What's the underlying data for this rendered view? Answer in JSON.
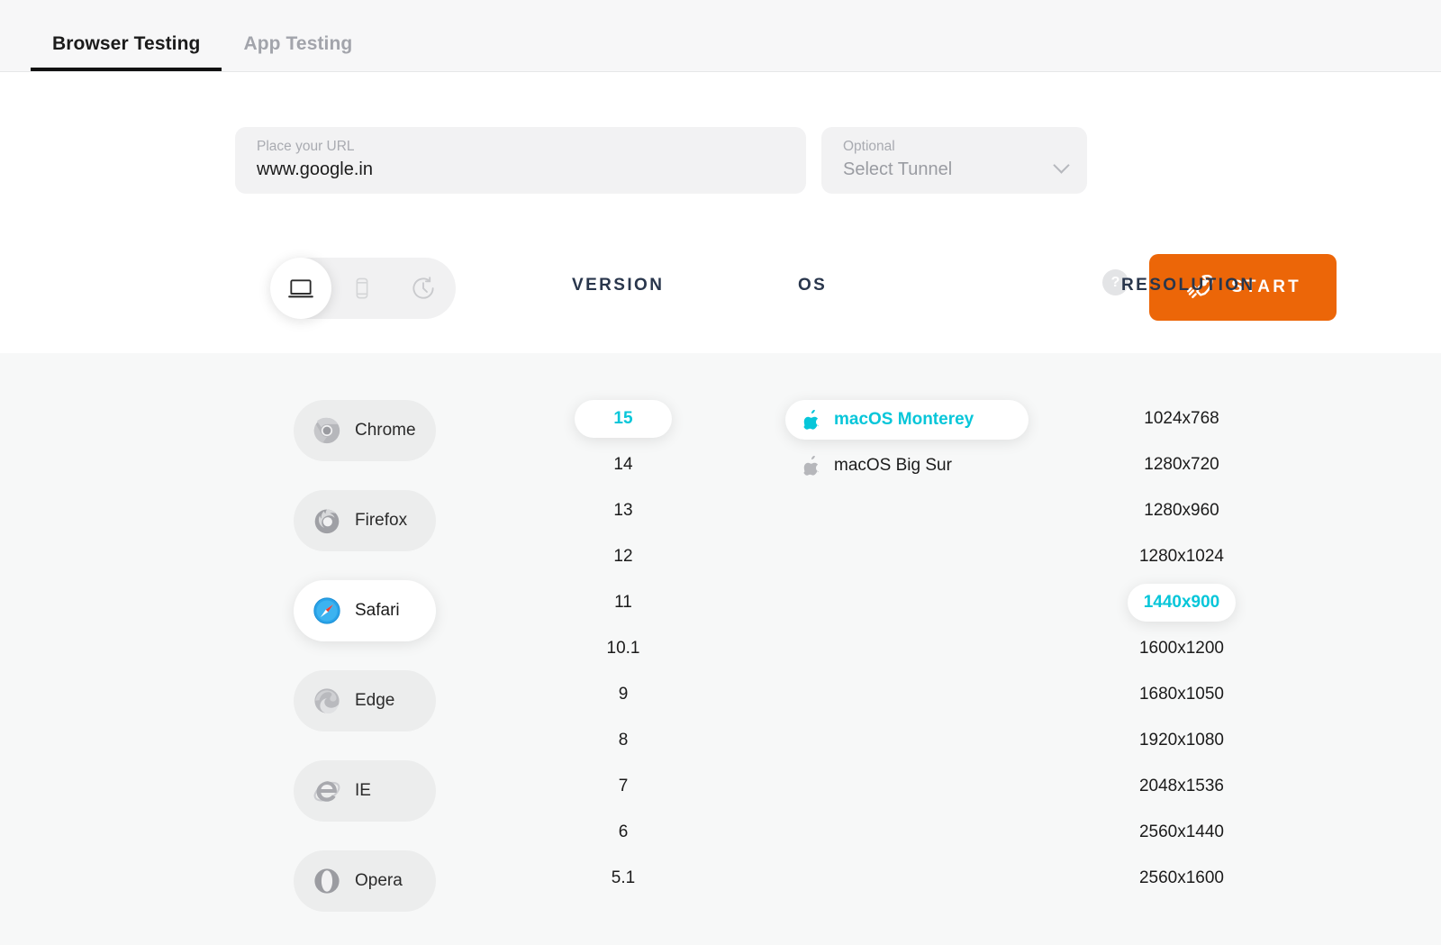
{
  "header": {
    "tabs": [
      {
        "label": "Browser Testing",
        "active": true
      },
      {
        "label": "App Testing",
        "active": false
      }
    ]
  },
  "controls": {
    "url_field": {
      "label": "Place your URL",
      "value": "www.google.in",
      "placeholder": "Place your URL"
    },
    "tunnel_field": {
      "label": "Optional",
      "value": "Select Tunnel",
      "icon": "chevron-down-icon"
    },
    "help": {
      "icon": "help-circle-icon",
      "glyph": "?"
    },
    "start_button": {
      "label": "START",
      "icon": "rocket-icon",
      "color": "#ec6608"
    }
  },
  "device_toggle": {
    "options": [
      {
        "name": "desktop",
        "icon": "desktop-icon",
        "selected": true
      },
      {
        "name": "mobile",
        "icon": "mobile-icon",
        "selected": false
      },
      {
        "name": "history",
        "icon": "history-icon",
        "selected": false
      }
    ]
  },
  "columns": {
    "version": "VERSION",
    "os": "OS",
    "resolution": "RESOLUTION"
  },
  "theme": {
    "accent_teal": "#07c6d9",
    "accent_orange": "#ec6608",
    "header_navy": "#29364c",
    "panel_bg": "#f7f8f8"
  },
  "browsers": [
    {
      "label": "Chrome",
      "icon": "chrome-icon",
      "selected": false
    },
    {
      "label": "Firefox",
      "icon": "firefox-icon",
      "selected": false
    },
    {
      "label": "Safari",
      "icon": "safari-icon",
      "selected": true
    },
    {
      "label": "Edge",
      "icon": "edge-icon",
      "selected": false
    },
    {
      "label": "IE",
      "icon": "ie-icon",
      "selected": false
    },
    {
      "label": "Opera",
      "icon": "opera-icon",
      "selected": false
    }
  ],
  "versions": [
    {
      "label": "15",
      "selected": true
    },
    {
      "label": "14",
      "selected": false
    },
    {
      "label": "13",
      "selected": false
    },
    {
      "label": "12",
      "selected": false
    },
    {
      "label": "11",
      "selected": false
    },
    {
      "label": "10.1",
      "selected": false
    },
    {
      "label": "9",
      "selected": false
    },
    {
      "label": "8",
      "selected": false
    },
    {
      "label": "7",
      "selected": false
    },
    {
      "label": "6",
      "selected": false
    },
    {
      "label": "5.1",
      "selected": false
    }
  ],
  "os_list": [
    {
      "label": "macOS Monterey",
      "icon": "apple-icon",
      "selected": true
    },
    {
      "label": "macOS Big Sur",
      "icon": "apple-icon",
      "selected": false
    }
  ],
  "resolutions": [
    {
      "label": "1024x768",
      "selected": false
    },
    {
      "label": "1280x720",
      "selected": false
    },
    {
      "label": "1280x960",
      "selected": false
    },
    {
      "label": "1280x1024",
      "selected": false
    },
    {
      "label": "1440x900",
      "selected": true
    },
    {
      "label": "1600x1200",
      "selected": false
    },
    {
      "label": "1680x1050",
      "selected": false
    },
    {
      "label": "1920x1080",
      "selected": false
    },
    {
      "label": "2048x1536",
      "selected": false
    },
    {
      "label": "2560x1440",
      "selected": false
    },
    {
      "label": "2560x1600",
      "selected": false
    }
  ]
}
